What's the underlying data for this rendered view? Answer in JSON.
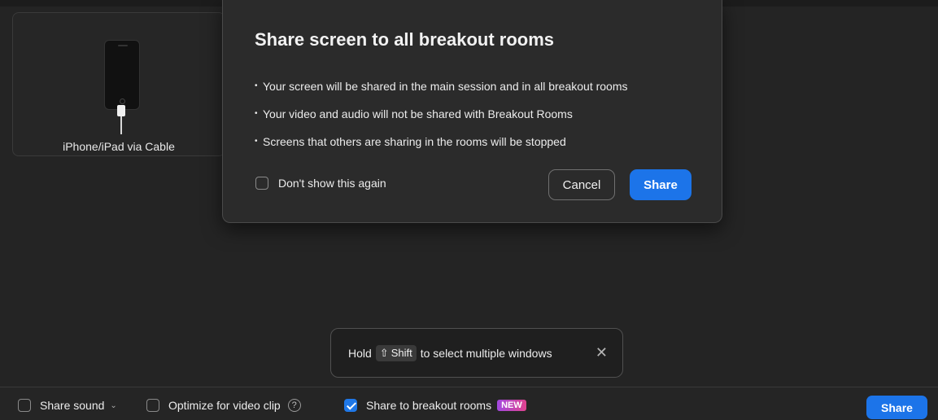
{
  "tile": {
    "label": "iPhone/iPad via Cable"
  },
  "dialog": {
    "title": "Share screen to all breakout rooms",
    "bullets": [
      "Your screen will be shared in the main session and in all breakout rooms",
      "Your video and audio will not be shared with Breakout Rooms",
      "Screens that others are sharing in the rooms will be stopped"
    ],
    "bullet_glyph": "•",
    "dont_show_label": "Don't show this again",
    "dont_show_checked": false,
    "cancel_label": "Cancel",
    "share_label": "Share"
  },
  "toast": {
    "prefix": "Hold",
    "key_glyph": "⇧",
    "key_label": "Shift",
    "suffix": "to select multiple windows",
    "close_glyph": "✕"
  },
  "bottom_bar": {
    "share_sound": {
      "label": "Share sound",
      "checked": false,
      "chevron": "⌄"
    },
    "optimize": {
      "label": "Optimize for video clip",
      "checked": false,
      "help": "?"
    },
    "breakout": {
      "label": "Share to breakout rooms",
      "checked": true,
      "badge": "NEW"
    },
    "share_label": "Share"
  },
  "colors": {
    "accent": "#1c74e9",
    "background": "#242424",
    "dialog": "#2b2b2b"
  }
}
